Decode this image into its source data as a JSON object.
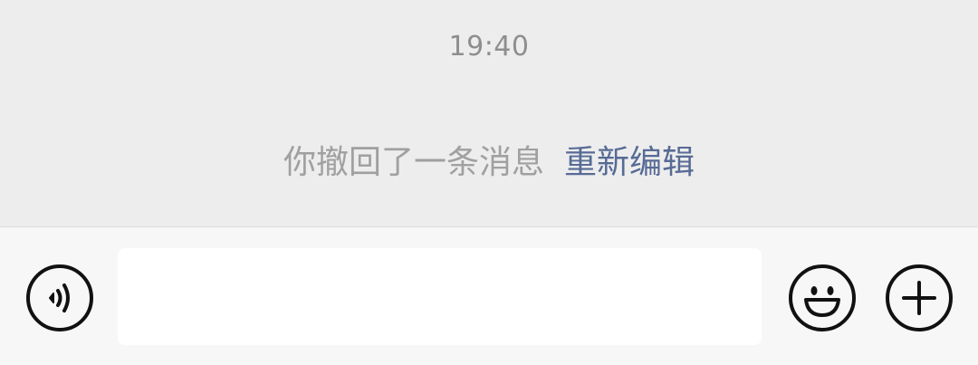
{
  "chat": {
    "timestamp": "19:40",
    "recall_text": "你撤回了一条消息",
    "reedit_label": "重新编辑"
  },
  "input_bar": {
    "input_value": "",
    "voice_icon": "voice-icon",
    "emoji_icon": "emoji-icon",
    "plus_icon": "plus-icon"
  },
  "colors": {
    "background": "#ededed",
    "input_bar_background": "#f7f7f7",
    "link": "#576b95",
    "system_text": "#a0a0a0",
    "timestamp_text": "#8e8e8e"
  }
}
